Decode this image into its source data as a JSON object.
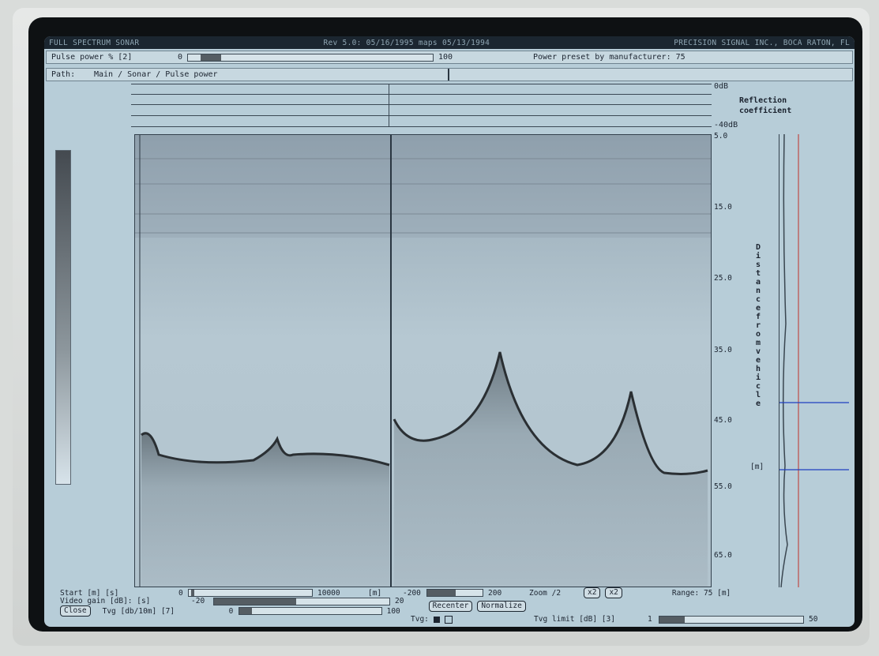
{
  "header": {
    "app_title": "FULL SPECTRUM SONAR",
    "revision": "Rev 5.0: 05/16/1995 maps 05/13/1994",
    "company": "PRECISION SIGNAL INC., BOCA RATON, FL"
  },
  "pulse_power": {
    "label": "Pulse power % [2]",
    "min": "0",
    "max": "100",
    "value_pct": 5,
    "preset_text": "Power preset by manufacturer: 75"
  },
  "path": {
    "label": "Path:",
    "value": "Main / Sonar / Pulse power"
  },
  "reflection": {
    "top_label": "0dB",
    "bottom_label": "-40dB",
    "title": "Reflection coefficient"
  },
  "depth_axis": {
    "ticks": [
      "5.0",
      "15.0",
      "25.0",
      "35.0",
      "45.0",
      "55.0",
      "65.0"
    ],
    "title": "Distance from vehicle",
    "unit": "[m]"
  },
  "controls": {
    "start_label": "Start [m] [s]",
    "start_min": "0",
    "start_max": "10000",
    "start_value_pct": 2,
    "m_unit": "[m]",
    "pan_min": "-200",
    "pan_max": "200",
    "pan_value_pct": 50,
    "zoom_label": "Zoom /2",
    "zoom_out": "x2",
    "zoom_in": "x2",
    "range_label": "Range: 75 [m]",
    "gain_label": "Video gain [dB]: [s]",
    "gain_min": "-20",
    "gain_max": "20",
    "gain_value_pct": 50,
    "tvg_label": "Tvg [db/10m] [7]",
    "tvg_min": "0",
    "tvg_max": "100",
    "tvg_value_pct": 8,
    "close_button": "Close",
    "recenter_button": "Recenter",
    "normalize_button": "Normalize",
    "tvg_toggle_label": "Tvg:",
    "tvg_limit_label": "Tvg limit [dB] [3]",
    "tvg_limit_min": "1",
    "tvg_limit_max": "50",
    "tvg_limit_value_pct": 8
  },
  "colors": {
    "screen_bg": "#b7cdd8",
    "trace_red": "#c03028",
    "trace_blue": "#2040c0"
  }
}
